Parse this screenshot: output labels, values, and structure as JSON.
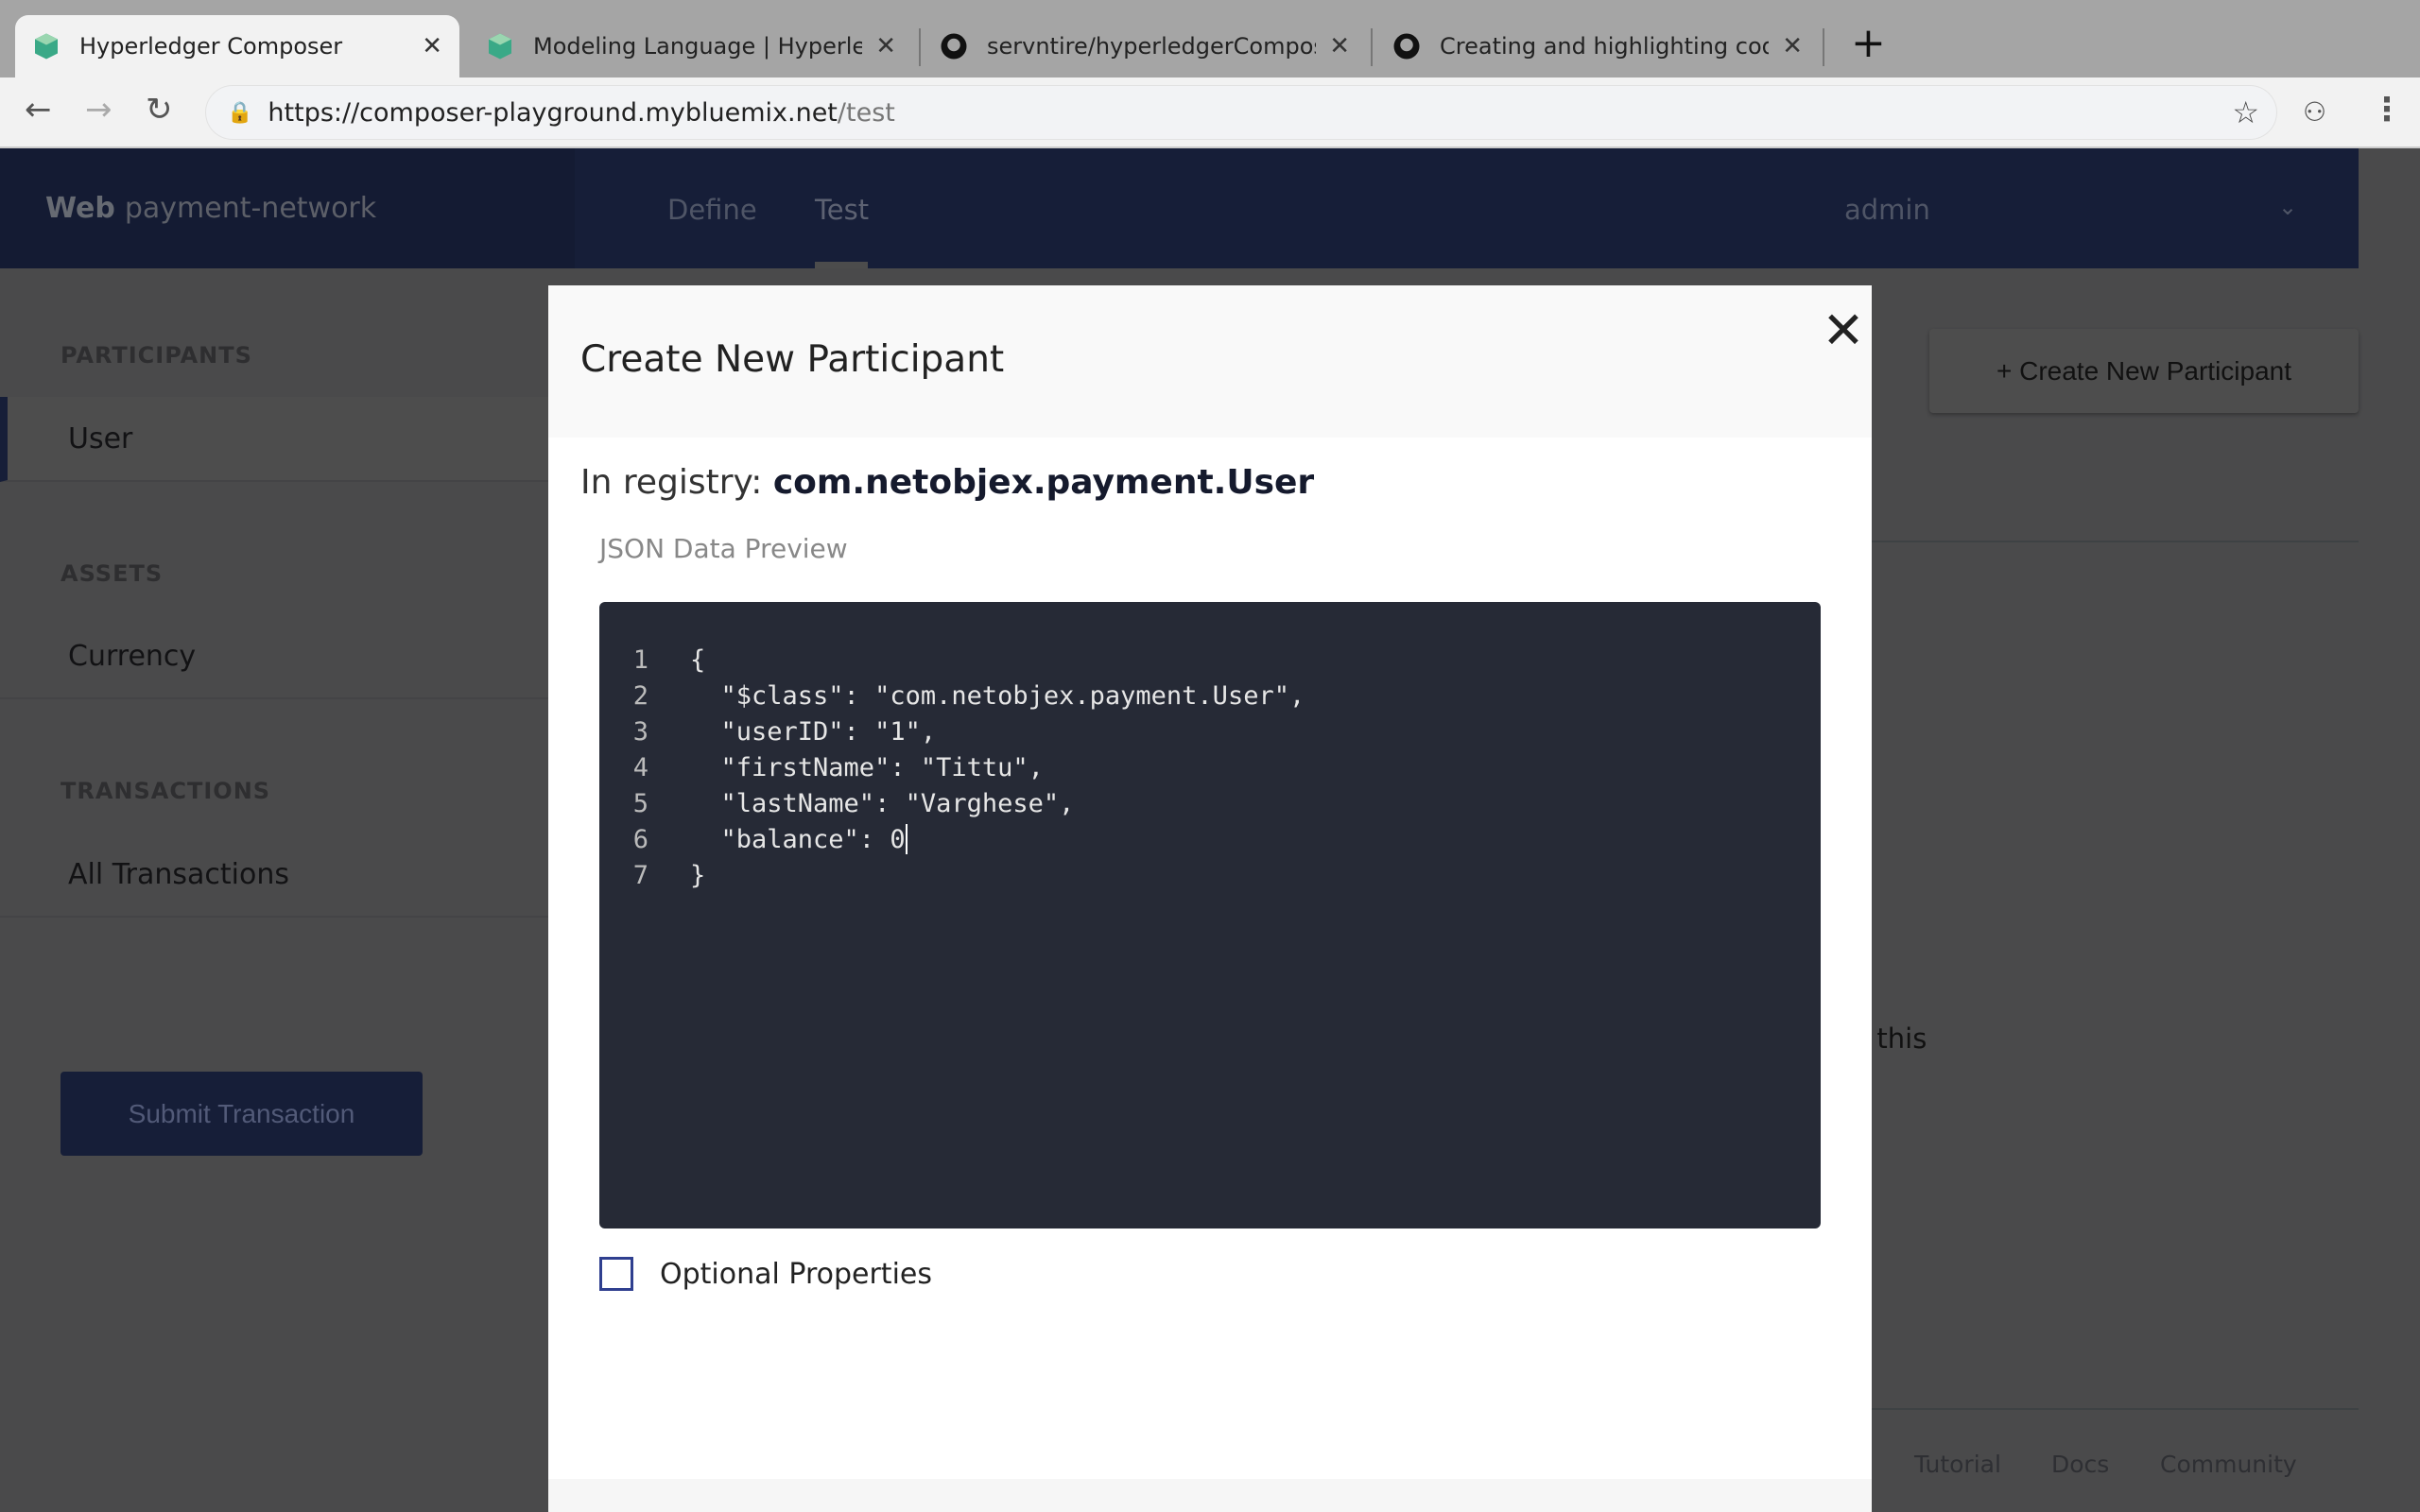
{
  "browser": {
    "tabs": [
      {
        "title": "Hyperledger Composer",
        "icon": "hyperledger-cube-icon",
        "active": true
      },
      {
        "title": "Modeling Language | Hyperledger",
        "icon": "hyperledger-cube-icon"
      },
      {
        "title": "servntire/hyperledgerComposer",
        "icon": "github-icon"
      },
      {
        "title": "Creating and highlighting code",
        "icon": "github-icon"
      }
    ],
    "url_host": "https://composer-playground.mybluemix.net",
    "url_path": "/test"
  },
  "app": {
    "brand_bold": "Web",
    "brand": "payment-network",
    "nav": [
      "Define",
      "Test"
    ],
    "active_nav": "Test",
    "user": "admin",
    "accent": "#2f3f8f"
  },
  "sidebar": {
    "sections": [
      {
        "label": "PARTICIPANTS",
        "items": [
          "User"
        ]
      },
      {
        "label": "ASSETS",
        "items": [
          "Currency"
        ]
      },
      {
        "label": "TRANSACTIONS",
        "items": [
          "All Transactions"
        ]
      }
    ],
    "submit": "Submit Transaction"
  },
  "main": {
    "create_button": "+ Create New Participant",
    "partial_text": "f this",
    "footer": [
      "Tutorial",
      "Docs",
      "Community"
    ]
  },
  "modal": {
    "title": "Create New Participant",
    "registry_label": "In registry:",
    "registry": "com.netobjex.payment.User",
    "preview_label": "JSON Data Preview",
    "code": [
      "{",
      "  \"$class\": \"com.netobjex.payment.User\",",
      "  \"userID\": \"1\",",
      "  \"firstName\": \"Tittu\",",
      "  \"lastName\": \"Varghese\",",
      "  \"balance\": 0",
      "}"
    ],
    "line_numbers": [
      "1",
      "2",
      "3",
      "4",
      "5",
      "6",
      "7"
    ],
    "optional_label": "Optional Properties",
    "optional_checked": false
  }
}
